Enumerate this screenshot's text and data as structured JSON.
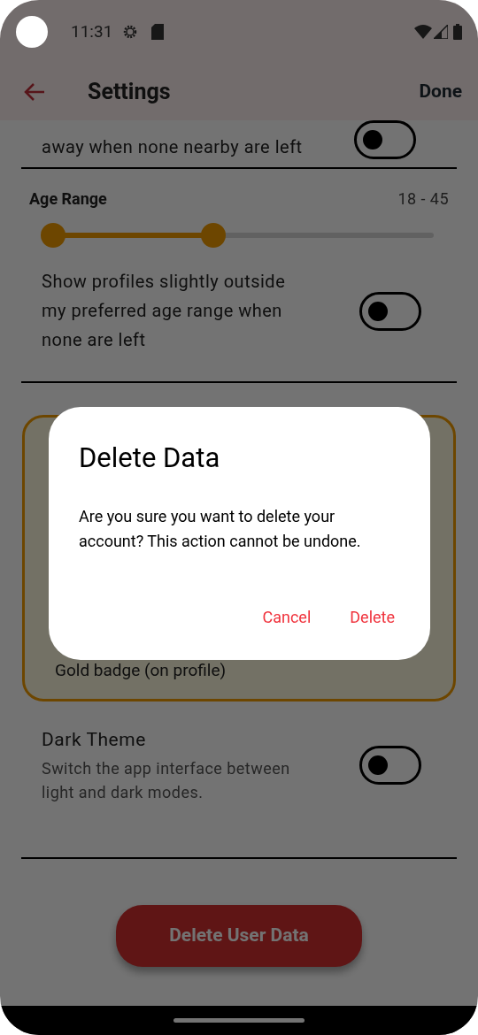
{
  "status_bar": {
    "time": "11:31"
  },
  "header": {
    "title": "Settings",
    "action": "Done"
  },
  "partial_setting": {
    "text": "away when none nearby are left",
    "toggle": {
      "checked": false
    }
  },
  "age_range": {
    "label": "Age Range",
    "reading": "18 - 45",
    "thumbs": [
      {
        "level": 0
      },
      {
        "level": 0.43
      }
    ]
  },
  "age_setting": {
    "text": "Show profiles slightly outside my preferred age range when none are left",
    "toggle": {
      "checked": false
    }
  },
  "premium_card": {
    "text": "Gold badge (on profile)"
  },
  "dark_theme": {
    "title": "Dark Theme",
    "description": "Switch the app interface between light and dark modes.",
    "toggle": {
      "checked": false
    }
  },
  "delete_button": "Delete User Data",
  "dialog": {
    "title": "Delete Data",
    "message": "Are you sure you want to delete your account? This action cannot be undone.",
    "buttons": [
      "Cancel",
      "Delete"
    ]
  }
}
